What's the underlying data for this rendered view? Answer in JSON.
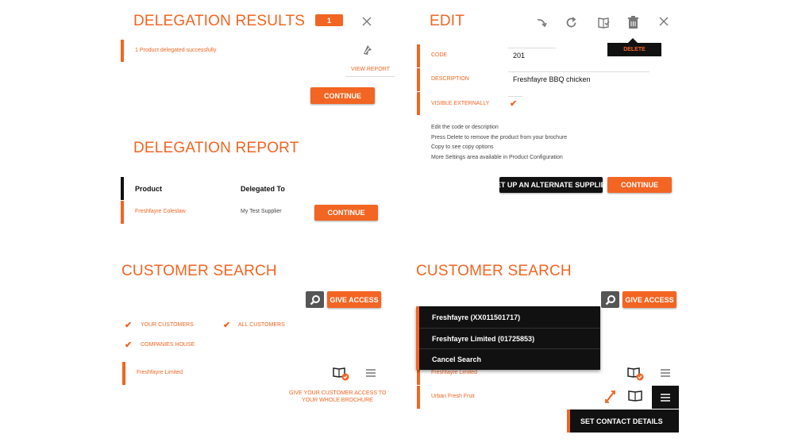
{
  "delegation_results": {
    "title": "DELEGATION RESULTS",
    "badge_count": "1",
    "message": "1 Product delegated successfully",
    "view_report": "VIEW REPORT",
    "continue": "CONTINUE"
  },
  "delegation_report": {
    "title": "DELEGATION REPORT",
    "col_product": "Product",
    "col_delegated_to": "Delegated To",
    "row_product": "Freshfayre Coleslaw",
    "row_supplier": "My Test Supplier",
    "continue": "CONTINUE"
  },
  "edit": {
    "title": "EDIT",
    "delete_tooltip": "DELETE",
    "fields": [
      {
        "label": "CODE",
        "value": "201"
      },
      {
        "label": "DESCRIPTION",
        "value": "Freshfayre BBQ chicken"
      },
      {
        "label": "VISIBLE EXTERNALLY",
        "value": ""
      }
    ],
    "help": [
      "Edit the code or description",
      "Press Delete to remove the product from your brochure",
      "Copy to see copy options",
      "More Settings area available in Product Configuration"
    ],
    "alt_supplier": "SET UP AN ALTERNATE SUPPLIER",
    "continue": "CONTINUE"
  },
  "customer_search_left": {
    "title": "CUSTOMER SEARCH",
    "give_access": "GIVE ACCESS",
    "filter_your": "YOUR CUSTOMERS",
    "filter_all": "ALL CUSTOMERS",
    "filter_companies": "COMPANIES HOUSE",
    "row_customer": "Freshfayre Limited",
    "give_access_hint_1": "GIVE YOUR CUSTOMER ACCESS TO",
    "give_access_hint_2": "YOUR WHOLE BROCHURE"
  },
  "customer_search_right": {
    "title": "CUSTOMER SEARCH",
    "give_access": "GIVE ACCESS",
    "dropdown": [
      "Freshfayre (XX011501717)",
      "Freshfayre Limited (01725853)",
      "Cancel Search"
    ],
    "row1_customer": "Freshfayre Limited",
    "row2_customer": "Urban Fresh Fruit",
    "context_menu_item": "SET CONTACT DETAILS"
  },
  "colors": {
    "accent": "#f26522",
    "dark": "#111111"
  },
  "icons": [
    "close-icon",
    "redo-icon",
    "refresh-icon",
    "copy-icon",
    "trash-icon",
    "search-icon",
    "brochure-icon",
    "menu-icon",
    "delegate-icon"
  ]
}
